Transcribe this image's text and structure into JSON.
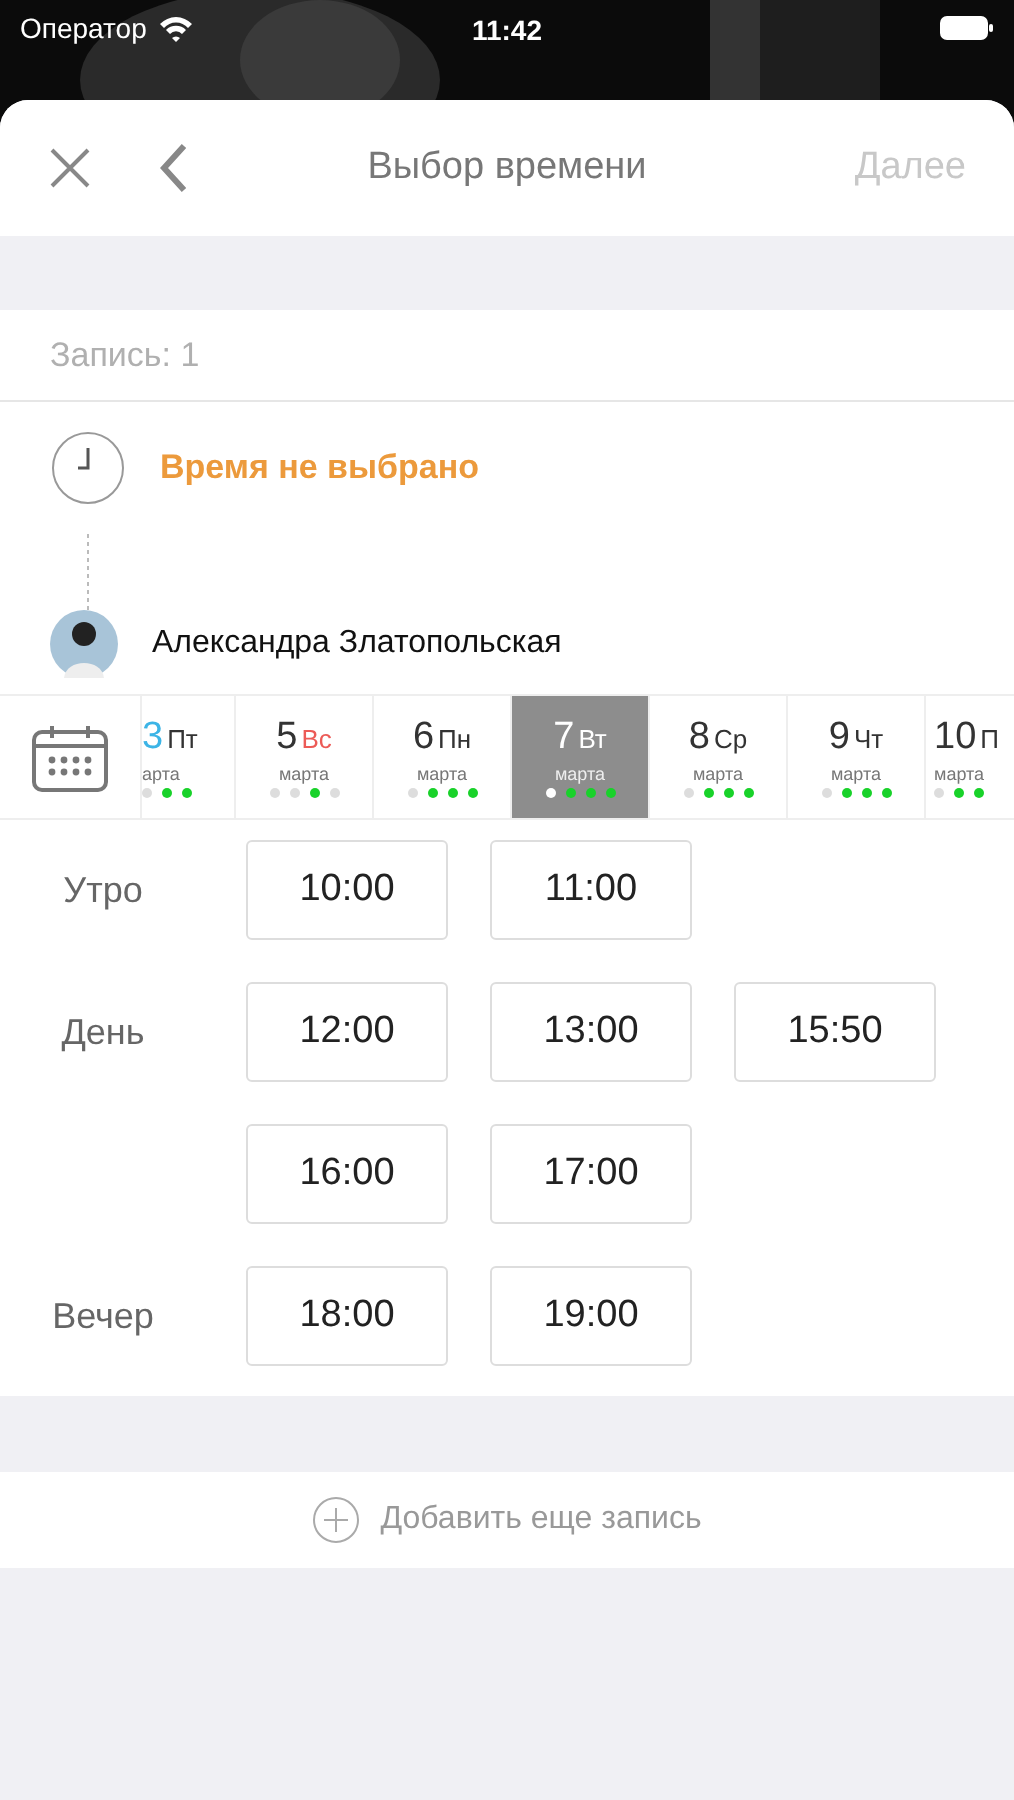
{
  "status_bar": {
    "carrier": "Оператор",
    "time": "11:42"
  },
  "header": {
    "title": "Выбор времени",
    "next": "Далее",
    "next_disabled": true
  },
  "booking": {
    "label": "Запись: 1",
    "time_status": "Время не выбрано",
    "specialist": "Александра Златопольская"
  },
  "days": [
    {
      "number": "3",
      "weekday": "Пт",
      "month": "арта",
      "selected": false,
      "kind": "today",
      "color": "#3cb4e6",
      "dots": [
        false,
        true,
        true
      ]
    },
    {
      "number": "5",
      "weekday": "Вс",
      "month": "марта",
      "selected": false,
      "kind": "weekend",
      "color": "#ec5b57",
      "dots": [
        false,
        false,
        true,
        false
      ]
    },
    {
      "number": "6",
      "weekday": "Пн",
      "month": "марта",
      "selected": false,
      "dots": [
        false,
        true,
        true,
        true
      ]
    },
    {
      "number": "7",
      "weekday": "Вт",
      "month": "марта",
      "selected": true,
      "dots": [
        false,
        true,
        true,
        true
      ]
    },
    {
      "number": "8",
      "weekday": "Ср",
      "month": "марта",
      "selected": false,
      "dots": [
        false,
        true,
        true,
        true
      ]
    },
    {
      "number": "9",
      "weekday": "Чт",
      "month": "марта",
      "selected": false,
      "dots": [
        false,
        true,
        true,
        true
      ]
    },
    {
      "number": "10",
      "weekday": "П",
      "month": "марта",
      "selected": false,
      "dots": [
        false,
        true,
        true
      ]
    }
  ],
  "periods": [
    {
      "label": "Утро",
      "rows": [
        [
          "10:00",
          "11:00"
        ]
      ]
    },
    {
      "label": "День",
      "rows": [
        [
          "12:00",
          "13:00",
          "15:50"
        ],
        [
          "16:00",
          "17:00"
        ]
      ]
    },
    {
      "label": "Вечер",
      "rows": [
        [
          "18:00",
          "19:00"
        ]
      ]
    }
  ],
  "add_button": "Добавить еще запись"
}
